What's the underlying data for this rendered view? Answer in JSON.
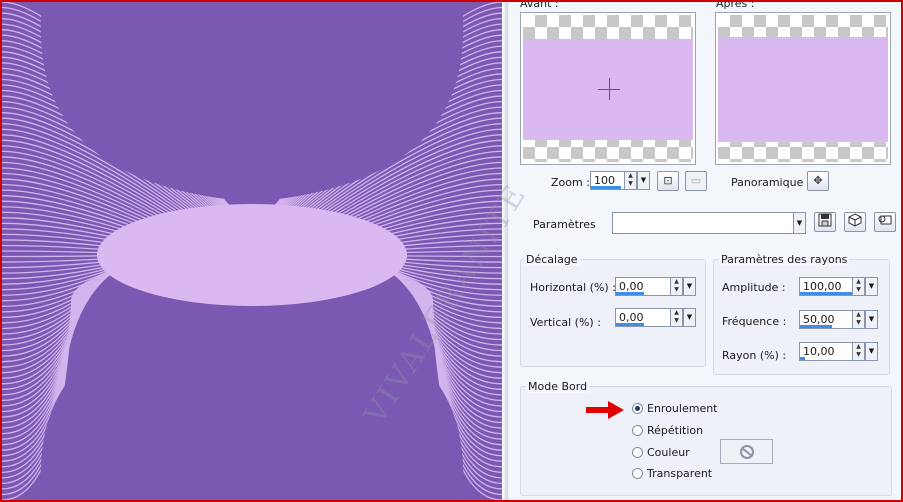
{
  "preview": {
    "before_label": "Avant :",
    "after_label": "Après :"
  },
  "zoom": {
    "label": "Zoom :",
    "value": "100"
  },
  "panoramique": {
    "label": "Panoramique :"
  },
  "params": {
    "label": "Paramètres",
    "value": ""
  },
  "decalage": {
    "title": "Décalage",
    "horizontal_label": "Horizontal (%) :",
    "horizontal_value": "0,00",
    "horizontal_fill": 0.5,
    "vertical_label": "Vertical (%) :",
    "vertical_value": "0,00",
    "vertical_fill": 0.5
  },
  "rayons": {
    "title": "Paramètres des rayons",
    "amplitude_label": "Amplitude :",
    "amplitude_value": "100,00",
    "amplitude_fill": 1.0,
    "frequence_label": "Fréquence :",
    "frequence_value": "50,00",
    "frequence_fill": 0.6,
    "rayon_label": "Rayon (%) :",
    "rayon_value": "10,00",
    "rayon_fill": 0.1
  },
  "mode_bord": {
    "title": "Mode Bord",
    "options": [
      "Enroulement",
      "Répétition",
      "Couleur",
      "Transparent"
    ],
    "selected": "Enroulement"
  },
  "watermark": "VIVALERANITE",
  "colors": {
    "canvas_bg": "#7b58b2",
    "lilac": "#d9b9f0",
    "accent_blue": "#3d8ee6",
    "arrow_red": "#e00000"
  },
  "icons": {
    "zoom_dropdown": "chevron-down-icon",
    "fit": "fit-window-icon",
    "actual_size": "actual-size-icon",
    "pan": "move-cross-icon",
    "save": "save-icon",
    "random": "dice-icon",
    "reset": "reset-icon",
    "no_color": "no-color-icon"
  }
}
